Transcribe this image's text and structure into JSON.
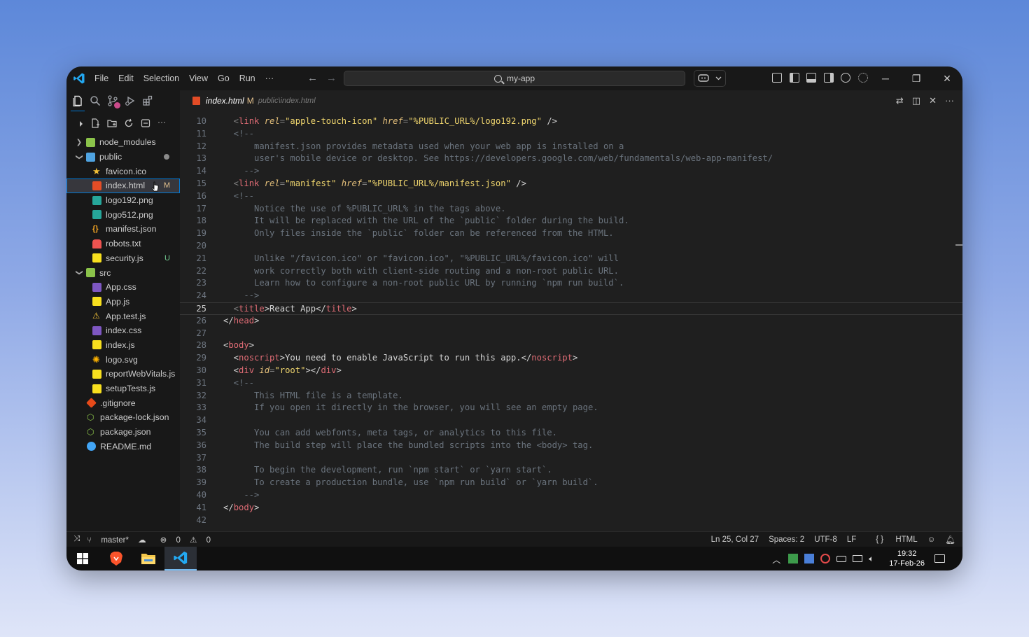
{
  "titlebar": {
    "menu": [
      "File",
      "Edit",
      "Selection",
      "View",
      "Go",
      "Run",
      "···"
    ],
    "nav_back": "←",
    "nav_forward": "→",
    "search_text": "my-app",
    "window_controls": {
      "minimize": "─",
      "restore": "❐",
      "close": "✕"
    }
  },
  "tab": {
    "filename": "index.html",
    "status": "M",
    "path": "public\\index.html"
  },
  "explorer": {
    "items": [
      {
        "label": "node_modules",
        "type": "folder",
        "expanded": false,
        "depth": 0,
        "icon": "folder-icon",
        "color": "#8bc34a"
      },
      {
        "label": "public",
        "type": "folder",
        "expanded": true,
        "depth": 0,
        "icon": "folder-open-icon",
        "color": "#4fa3e0",
        "dot": true
      },
      {
        "label": "favicon.ico",
        "depth": 1,
        "icon": "star-icon",
        "color": "#f2c037"
      },
      {
        "label": "index.html",
        "depth": 1,
        "icon": "html-icon",
        "color": "#e44d26",
        "status": "M",
        "selected": true
      },
      {
        "label": "logo192.png",
        "depth": 1,
        "icon": "image-icon",
        "color": "#26a69a"
      },
      {
        "label": "logo512.png",
        "depth": 1,
        "icon": "image-icon",
        "color": "#26a69a"
      },
      {
        "label": "manifest.json",
        "depth": 1,
        "icon": "braces-icon",
        "color": "#f5a623"
      },
      {
        "label": "robots.txt",
        "depth": 1,
        "icon": "robot-icon",
        "color": "#ef5350"
      },
      {
        "label": "security.js",
        "depth": 1,
        "icon": "js-icon",
        "color": "#f7df1e",
        "status": "U"
      },
      {
        "label": "src",
        "type": "folder",
        "expanded": true,
        "depth": 0,
        "icon": "folder-open-icon",
        "color": "#8bc34a"
      },
      {
        "label": "App.css",
        "depth": 1,
        "icon": "css-icon",
        "color": "#7e57c2"
      },
      {
        "label": "App.js",
        "depth": 1,
        "icon": "js-icon",
        "color": "#f7df1e"
      },
      {
        "label": "App.test.js",
        "depth": 1,
        "icon": "flask-icon",
        "color": "#f2c037"
      },
      {
        "label": "index.css",
        "depth": 1,
        "icon": "css-icon",
        "color": "#7e57c2"
      },
      {
        "label": "index.js",
        "depth": 1,
        "icon": "js-icon",
        "color": "#f7df1e"
      },
      {
        "label": "logo.svg",
        "depth": 1,
        "icon": "svg-icon",
        "color": "#ffb300"
      },
      {
        "label": "reportWebVitals.js",
        "depth": 1,
        "icon": "js-icon",
        "color": "#f7df1e"
      },
      {
        "label": "setupTests.js",
        "depth": 1,
        "icon": "js-icon",
        "color": "#f7df1e"
      },
      {
        "label": ".gitignore",
        "depth": 0,
        "icon": "git-icon",
        "color": "#e64a19"
      },
      {
        "label": "package-lock.json",
        "depth": 0,
        "icon": "nodejs-icon",
        "color": "#8bc34a"
      },
      {
        "label": "package.json",
        "depth": 0,
        "icon": "nodejs-icon",
        "color": "#8bc34a"
      },
      {
        "label": "README.md",
        "depth": 0,
        "icon": "info-icon",
        "color": "#42a5f5"
      }
    ]
  },
  "editor": {
    "current_line": 25,
    "lines": [
      {
        "n": "10",
        "tokens": [
          [
            "punc",
            "  <"
          ],
          [
            "tag",
            "link"
          ],
          [
            "txt",
            " "
          ],
          [
            "attr",
            "rel"
          ],
          [
            "punc",
            "="
          ],
          [
            "str",
            "\"apple-touch-icon\""
          ],
          [
            "txt",
            " "
          ],
          [
            "attr",
            "href"
          ],
          [
            "punc",
            "="
          ],
          [
            "str",
            "\"%PUBLIC_URL%/logo192.png\""
          ],
          [
            "txt",
            " />"
          ]
        ]
      },
      {
        "n": "11",
        "tokens": [
          [
            "com",
            "  <!--"
          ]
        ]
      },
      {
        "n": "12",
        "tokens": [
          [
            "com",
            "      manifest.json provides metadata used when your web app is installed on a"
          ]
        ]
      },
      {
        "n": "13",
        "tokens": [
          [
            "com",
            "      user's mobile device or desktop. See https://developers.google.com/web/fundamentals/web-app-manifest/"
          ]
        ]
      },
      {
        "n": "14",
        "tokens": [
          [
            "com",
            "    -->"
          ]
        ]
      },
      {
        "n": "15",
        "tokens": [
          [
            "punc",
            "  <"
          ],
          [
            "tag",
            "link"
          ],
          [
            "txt",
            " "
          ],
          [
            "attr",
            "rel"
          ],
          [
            "punc",
            "="
          ],
          [
            "str",
            "\"manifest\""
          ],
          [
            "txt",
            " "
          ],
          [
            "attr",
            "href"
          ],
          [
            "punc",
            "="
          ],
          [
            "str",
            "\"%PUBLIC_URL%/manifest.json\""
          ],
          [
            "txt",
            " />"
          ]
        ]
      },
      {
        "n": "16",
        "tokens": [
          [
            "com",
            "  <!--"
          ]
        ]
      },
      {
        "n": "17",
        "tokens": [
          [
            "com",
            "      Notice the use of %PUBLIC_URL% in the tags above."
          ]
        ]
      },
      {
        "n": "18",
        "tokens": [
          [
            "com",
            "      It will be replaced with the URL of the `public` folder during the build."
          ]
        ]
      },
      {
        "n": "19",
        "tokens": [
          [
            "com",
            "      Only files inside the `public` folder can be referenced from the HTML."
          ]
        ]
      },
      {
        "n": "20",
        "tokens": []
      },
      {
        "n": "21",
        "tokens": [
          [
            "com",
            "      Unlike \"/favicon.ico\" or \"favicon.ico\", \"%PUBLIC_URL%/favicon.ico\" will"
          ]
        ]
      },
      {
        "n": "22",
        "tokens": [
          [
            "com",
            "      work correctly both with client-side routing and a non-root public URL."
          ]
        ]
      },
      {
        "n": "23",
        "tokens": [
          [
            "com",
            "      Learn how to configure a non-root public URL by running `npm run build`."
          ]
        ]
      },
      {
        "n": "24",
        "tokens": [
          [
            "com",
            "    -->"
          ]
        ]
      },
      {
        "n": "25",
        "tokens": [
          [
            "punc",
            "  <"
          ],
          [
            "tag",
            "title"
          ],
          [
            "txt",
            ">React App</"
          ],
          [
            "tag",
            "title"
          ],
          [
            "txt",
            ">"
          ]
        ]
      },
      {
        "n": "26",
        "tokens": [
          [
            "txt",
            "</"
          ],
          [
            "tag",
            "head"
          ],
          [
            "txt",
            ">"
          ]
        ]
      },
      {
        "n": "27",
        "tokens": []
      },
      {
        "n": "28",
        "tokens": [
          [
            "txt",
            "<"
          ],
          [
            "tag",
            "body"
          ],
          [
            "txt",
            ">"
          ]
        ]
      },
      {
        "n": "29",
        "tokens": [
          [
            "txt",
            "  <"
          ],
          [
            "tag",
            "noscript"
          ],
          [
            "txt",
            ">You need to enable JavaScript to run this app.</"
          ],
          [
            "tag",
            "noscript"
          ],
          [
            "txt",
            ">"
          ]
        ]
      },
      {
        "n": "30",
        "tokens": [
          [
            "txt",
            "  <"
          ],
          [
            "tag",
            "div"
          ],
          [
            "txt",
            " "
          ],
          [
            "attr",
            "id"
          ],
          [
            "punc",
            "="
          ],
          [
            "str",
            "\"root\""
          ],
          [
            "txt",
            "></"
          ],
          [
            "tag",
            "div"
          ],
          [
            "txt",
            ">"
          ]
        ]
      },
      {
        "n": "31",
        "tokens": [
          [
            "com",
            "  <!--"
          ]
        ]
      },
      {
        "n": "32",
        "tokens": [
          [
            "com",
            "      This HTML file is a template."
          ]
        ]
      },
      {
        "n": "33",
        "tokens": [
          [
            "com",
            "      If you open it directly in the browser, you will see an empty page."
          ]
        ]
      },
      {
        "n": "34",
        "tokens": []
      },
      {
        "n": "35",
        "tokens": [
          [
            "com",
            "      You can add webfonts, meta tags, or analytics to this file."
          ]
        ]
      },
      {
        "n": "36",
        "tokens": [
          [
            "com",
            "      The build step will place the bundled scripts into the <body> tag."
          ]
        ]
      },
      {
        "n": "37",
        "tokens": []
      },
      {
        "n": "38",
        "tokens": [
          [
            "com",
            "      To begin the development, run `npm start` or `yarn start`."
          ]
        ]
      },
      {
        "n": "39",
        "tokens": [
          [
            "com",
            "      To create a production bundle, use `npm run build` or `yarn build`."
          ]
        ]
      },
      {
        "n": "40",
        "tokens": [
          [
            "com",
            "    -->"
          ]
        ]
      },
      {
        "n": "41",
        "tokens": [
          [
            "txt",
            "</"
          ],
          [
            "tag",
            "body"
          ],
          [
            "txt",
            ">"
          ]
        ]
      },
      {
        "n": "42",
        "tokens": []
      }
    ]
  },
  "statusbar": {
    "branch": "master*",
    "errors": "0",
    "warnings": "0",
    "cursor": "Ln 25, Col 27",
    "spaces": "Spaces: 2",
    "encoding": "UTF-8",
    "eol": "LF",
    "language": "HTML"
  },
  "taskbar": {
    "time": "19:32",
    "date": "17-Feb-26"
  },
  "colors": {
    "accent": "#0078d4",
    "modified": "#e2c08d",
    "untracked": "#73c991"
  }
}
